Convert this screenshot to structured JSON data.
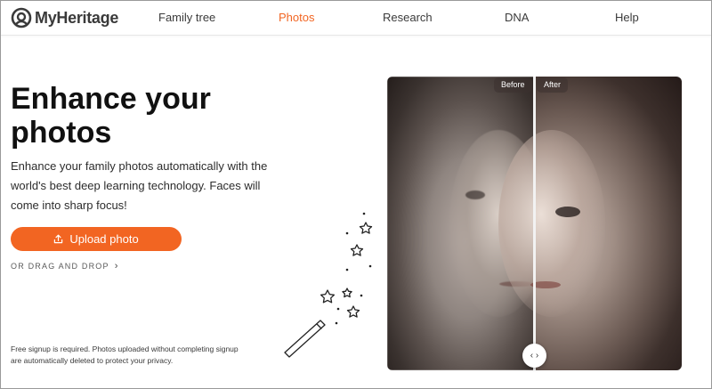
{
  "brand": {
    "name": "MyHeritage",
    "accent": "#f26522"
  },
  "nav": {
    "items": [
      {
        "label": "Family tree",
        "active": false
      },
      {
        "label": "Photos",
        "active": true
      },
      {
        "label": "Research",
        "active": false
      },
      {
        "label": "DNA",
        "active": false
      },
      {
        "label": "Help",
        "active": false
      }
    ]
  },
  "hero": {
    "title": "Enhance your photos",
    "description": "Enhance your family photos automatically with the world's best deep learning technology. Faces will come into sharp focus!",
    "upload_label": "Upload photo",
    "upload_icon": "upload-icon",
    "drag_label": "OR DRAG AND DROP",
    "footnote": "Free signup is required. Photos uploaded without completing signup are automatically deleted to protect your privacy."
  },
  "compare": {
    "before_label": "Before",
    "after_label": "After",
    "handle_icon": "chevron-left-right-icon",
    "split_fraction": 0.5
  }
}
